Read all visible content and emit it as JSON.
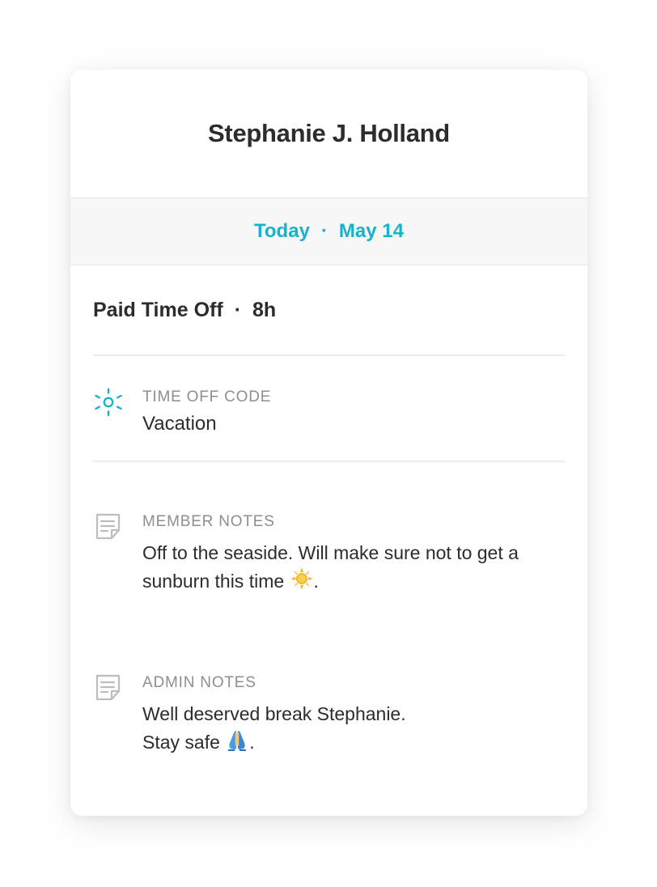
{
  "card": {
    "member_name": "Stephanie J. Holland",
    "date": {
      "relative": "Today",
      "separator": "·",
      "date": "May 14"
    },
    "summary": {
      "type": "Paid Time Off",
      "separator": "·",
      "hours": "8h"
    },
    "time_off_code": {
      "icon": "sun-icon",
      "label": "TIME OFF CODE",
      "value": "Vacation"
    },
    "member_notes": {
      "icon": "note-icon",
      "label": "MEMBER NOTES",
      "text": "Off to the seaside. Will make sure not to get a sunburn this time",
      "emoji": "sun-emoji",
      "suffix": "."
    },
    "admin_notes": {
      "icon": "note-icon",
      "label": "ADMIN NOTES",
      "line1": "Well deserved break Stephanie.",
      "line2": "Stay safe",
      "emoji": "pray-emoji",
      "suffix": "."
    }
  },
  "colors": {
    "accent": "#14b3cc",
    "text": "#2c2c2c",
    "muted": "#8e8e8e",
    "band": "#f7f7f7"
  }
}
